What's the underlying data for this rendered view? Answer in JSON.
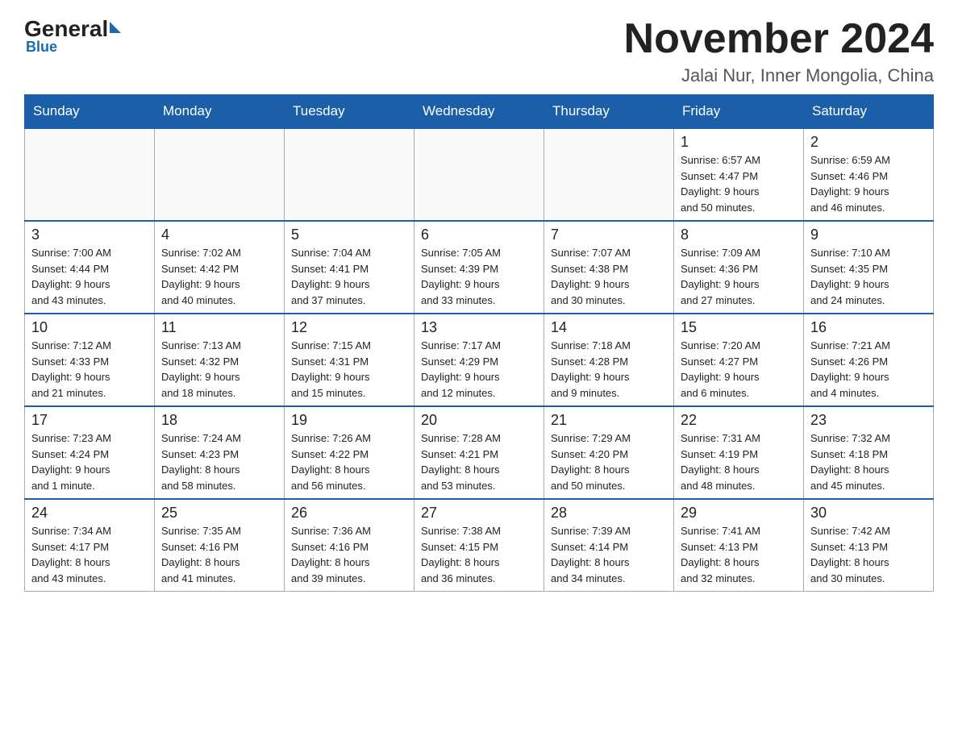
{
  "logo": {
    "general": "General",
    "blue": "Blue"
  },
  "title": "November 2024",
  "location": "Jalai Nur, Inner Mongolia, China",
  "days_of_week": [
    "Sunday",
    "Monday",
    "Tuesday",
    "Wednesday",
    "Thursday",
    "Friday",
    "Saturday"
  ],
  "weeks": [
    [
      {
        "day": "",
        "info": ""
      },
      {
        "day": "",
        "info": ""
      },
      {
        "day": "",
        "info": ""
      },
      {
        "day": "",
        "info": ""
      },
      {
        "day": "",
        "info": ""
      },
      {
        "day": "1",
        "info": "Sunrise: 6:57 AM\nSunset: 4:47 PM\nDaylight: 9 hours\nand 50 minutes."
      },
      {
        "day": "2",
        "info": "Sunrise: 6:59 AM\nSunset: 4:46 PM\nDaylight: 9 hours\nand 46 minutes."
      }
    ],
    [
      {
        "day": "3",
        "info": "Sunrise: 7:00 AM\nSunset: 4:44 PM\nDaylight: 9 hours\nand 43 minutes."
      },
      {
        "day": "4",
        "info": "Sunrise: 7:02 AM\nSunset: 4:42 PM\nDaylight: 9 hours\nand 40 minutes."
      },
      {
        "day": "5",
        "info": "Sunrise: 7:04 AM\nSunset: 4:41 PM\nDaylight: 9 hours\nand 37 minutes."
      },
      {
        "day": "6",
        "info": "Sunrise: 7:05 AM\nSunset: 4:39 PM\nDaylight: 9 hours\nand 33 minutes."
      },
      {
        "day": "7",
        "info": "Sunrise: 7:07 AM\nSunset: 4:38 PM\nDaylight: 9 hours\nand 30 minutes."
      },
      {
        "day": "8",
        "info": "Sunrise: 7:09 AM\nSunset: 4:36 PM\nDaylight: 9 hours\nand 27 minutes."
      },
      {
        "day": "9",
        "info": "Sunrise: 7:10 AM\nSunset: 4:35 PM\nDaylight: 9 hours\nand 24 minutes."
      }
    ],
    [
      {
        "day": "10",
        "info": "Sunrise: 7:12 AM\nSunset: 4:33 PM\nDaylight: 9 hours\nand 21 minutes."
      },
      {
        "day": "11",
        "info": "Sunrise: 7:13 AM\nSunset: 4:32 PM\nDaylight: 9 hours\nand 18 minutes."
      },
      {
        "day": "12",
        "info": "Sunrise: 7:15 AM\nSunset: 4:31 PM\nDaylight: 9 hours\nand 15 minutes."
      },
      {
        "day": "13",
        "info": "Sunrise: 7:17 AM\nSunset: 4:29 PM\nDaylight: 9 hours\nand 12 minutes."
      },
      {
        "day": "14",
        "info": "Sunrise: 7:18 AM\nSunset: 4:28 PM\nDaylight: 9 hours\nand 9 minutes."
      },
      {
        "day": "15",
        "info": "Sunrise: 7:20 AM\nSunset: 4:27 PM\nDaylight: 9 hours\nand 6 minutes."
      },
      {
        "day": "16",
        "info": "Sunrise: 7:21 AM\nSunset: 4:26 PM\nDaylight: 9 hours\nand 4 minutes."
      }
    ],
    [
      {
        "day": "17",
        "info": "Sunrise: 7:23 AM\nSunset: 4:24 PM\nDaylight: 9 hours\nand 1 minute."
      },
      {
        "day": "18",
        "info": "Sunrise: 7:24 AM\nSunset: 4:23 PM\nDaylight: 8 hours\nand 58 minutes."
      },
      {
        "day": "19",
        "info": "Sunrise: 7:26 AM\nSunset: 4:22 PM\nDaylight: 8 hours\nand 56 minutes."
      },
      {
        "day": "20",
        "info": "Sunrise: 7:28 AM\nSunset: 4:21 PM\nDaylight: 8 hours\nand 53 minutes."
      },
      {
        "day": "21",
        "info": "Sunrise: 7:29 AM\nSunset: 4:20 PM\nDaylight: 8 hours\nand 50 minutes."
      },
      {
        "day": "22",
        "info": "Sunrise: 7:31 AM\nSunset: 4:19 PM\nDaylight: 8 hours\nand 48 minutes."
      },
      {
        "day": "23",
        "info": "Sunrise: 7:32 AM\nSunset: 4:18 PM\nDaylight: 8 hours\nand 45 minutes."
      }
    ],
    [
      {
        "day": "24",
        "info": "Sunrise: 7:34 AM\nSunset: 4:17 PM\nDaylight: 8 hours\nand 43 minutes."
      },
      {
        "day": "25",
        "info": "Sunrise: 7:35 AM\nSunset: 4:16 PM\nDaylight: 8 hours\nand 41 minutes."
      },
      {
        "day": "26",
        "info": "Sunrise: 7:36 AM\nSunset: 4:16 PM\nDaylight: 8 hours\nand 39 minutes."
      },
      {
        "day": "27",
        "info": "Sunrise: 7:38 AM\nSunset: 4:15 PM\nDaylight: 8 hours\nand 36 minutes."
      },
      {
        "day": "28",
        "info": "Sunrise: 7:39 AM\nSunset: 4:14 PM\nDaylight: 8 hours\nand 34 minutes."
      },
      {
        "day": "29",
        "info": "Sunrise: 7:41 AM\nSunset: 4:13 PM\nDaylight: 8 hours\nand 32 minutes."
      },
      {
        "day": "30",
        "info": "Sunrise: 7:42 AM\nSunset: 4:13 PM\nDaylight: 8 hours\nand 30 minutes."
      }
    ]
  ]
}
